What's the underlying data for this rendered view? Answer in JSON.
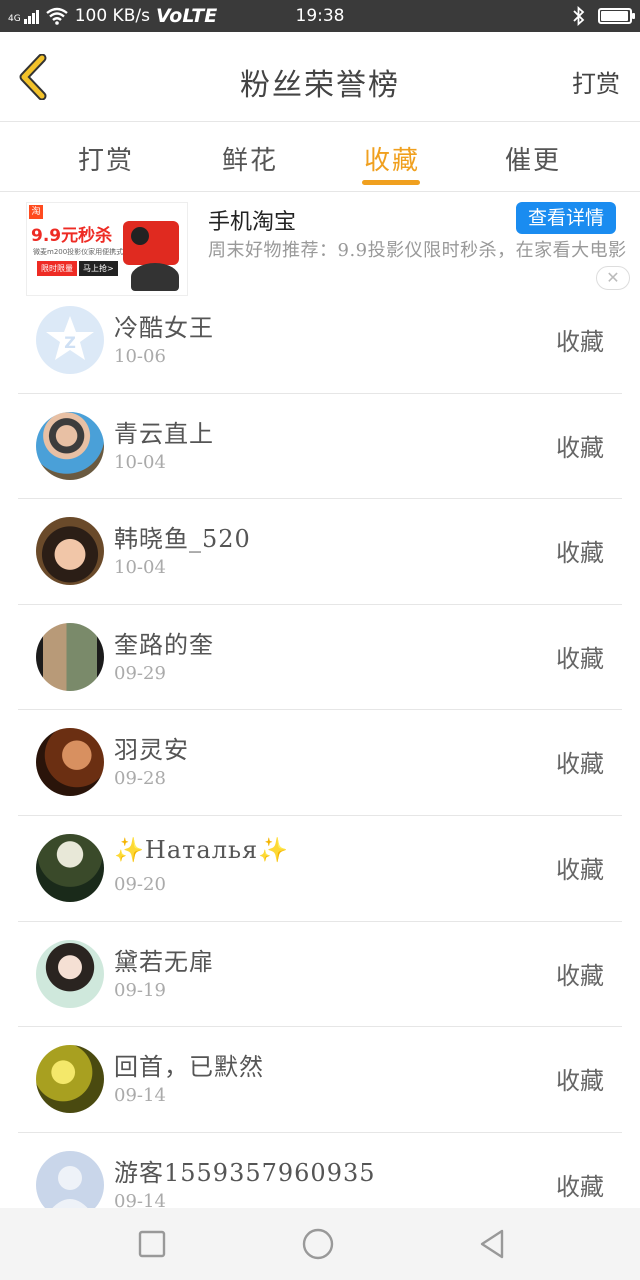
{
  "status_bar": {
    "signal": "4G",
    "speed": "100 KB/s",
    "volte": "VoLTE",
    "time": "19:38",
    "battery_level": 0.95,
    "icons": [
      "signal-icon",
      "wifi-icon",
      "bluetooth-icon",
      "battery-icon"
    ]
  },
  "header": {
    "title": "粉丝荣誉榜",
    "right_action": "打赏",
    "back_icon": "chevron-left-icon"
  },
  "tabs": [
    {
      "label": "打赏",
      "active": false
    },
    {
      "label": "鲜花",
      "active": false
    },
    {
      "label": "收藏",
      "active": true
    },
    {
      "label": "催更",
      "active": false
    }
  ],
  "ad": {
    "image_text": {
      "logo": "淘",
      "promo": "9.9元秒杀",
      "subtitle": "微麦m200投影仪家用便携式",
      "badge1": "限时限量",
      "badge2": "马上抢>"
    },
    "name": "手机淘宝",
    "cta": "查看详情",
    "description": "周末好物推荐：9.9投影仪限时秒杀，在家看大电影",
    "close": "✕"
  },
  "list": [
    {
      "name": "冷酷女王",
      "date": "10-06",
      "action": "收藏",
      "avatar": "qq-default"
    },
    {
      "name": "青云直上",
      "date": "10-04",
      "action": "收藏",
      "avatar": "photo-boy"
    },
    {
      "name": "韩晓鱼_520",
      "date": "10-04",
      "action": "收藏",
      "avatar": "photo-girl"
    },
    {
      "name": "奎路的奎",
      "date": "09-29",
      "action": "收藏",
      "avatar": "photo-couple"
    },
    {
      "name": "羽灵安",
      "date": "09-28",
      "action": "收藏",
      "avatar": "photo-anime"
    },
    {
      "name": "✨Наталья✨",
      "date": "09-20",
      "action": "收藏",
      "avatar": "photo-hat"
    },
    {
      "name": "黛若无扉",
      "date": "09-19",
      "action": "收藏",
      "avatar": "photo-drawing"
    },
    {
      "name": "回首，已默然",
      "date": "09-14",
      "action": "收藏",
      "avatar": "photo-nature"
    },
    {
      "name": "游客1559357960935",
      "date": "09-14",
      "action": "收藏",
      "avatar": "default-user"
    }
  ],
  "nav_bar": {
    "icons": [
      "recent-apps-icon",
      "home-icon",
      "back-icon"
    ]
  },
  "colors": {
    "accent": "#f0a01f",
    "cta_blue": "#1a8cf0",
    "status_bar": "#3a3a3a"
  }
}
